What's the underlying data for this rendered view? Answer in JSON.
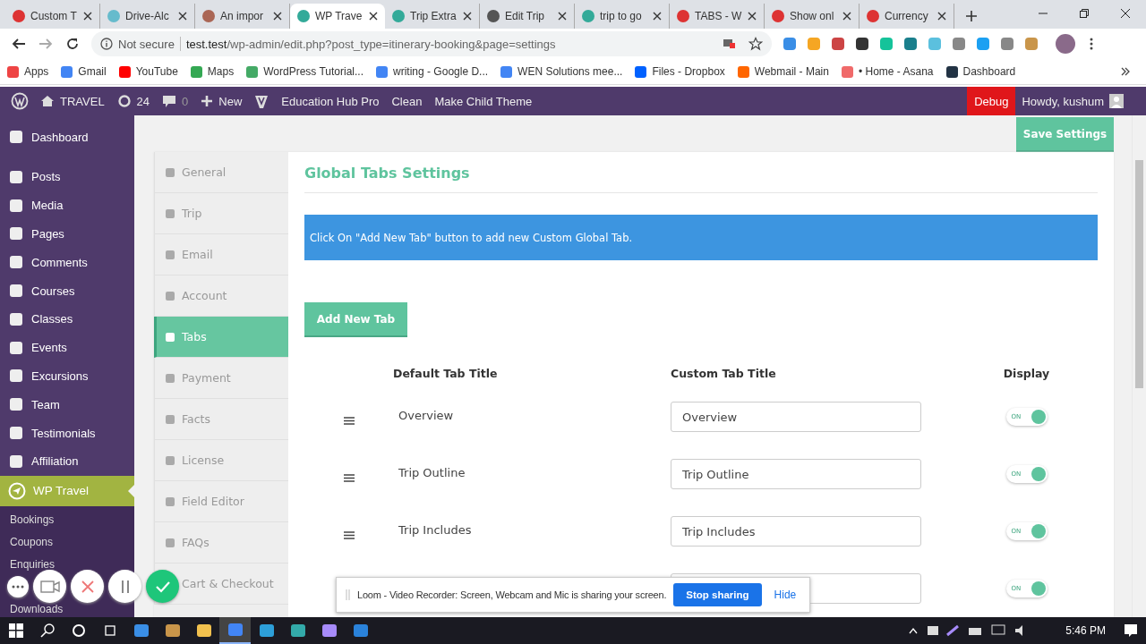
{
  "browser": {
    "tabs": [
      {
        "title": "Custom T",
        "selected": false
      },
      {
        "title": "Drive-Alc",
        "selected": false
      },
      {
        "title": "An impor",
        "selected": false
      },
      {
        "title": "WP Trave",
        "selected": true
      },
      {
        "title": "Trip Extra",
        "selected": false
      },
      {
        "title": "Edit Trip",
        "selected": false
      },
      {
        "title": "trip to go",
        "selected": false
      },
      {
        "title": "TABS - W",
        "selected": false
      },
      {
        "title": "Show onl",
        "selected": false
      },
      {
        "title": "Currency",
        "selected": false
      }
    ],
    "security": "Not secure",
    "url_host": "test.test",
    "url_path": "/wp-admin/edit.php?post_type=itinerary-booking&page=settings",
    "bookmarks": [
      "Apps",
      "Gmail",
      "YouTube",
      "Maps",
      "WordPress Tutorial...",
      "writing - Google D...",
      "WEN Solutions mee...",
      "Files - Dropbox",
      "Webmail - Main",
      "• Home - Asana",
      "Dashboard"
    ]
  },
  "admin_bar": {
    "site": "TRAVEL",
    "updates": "24",
    "comments": "0",
    "new": "New",
    "links": [
      "Education Hub Pro",
      "Clean",
      "Make Child Theme"
    ],
    "debug": "Debug",
    "howdy": "Howdy, kushum"
  },
  "sidebar": {
    "items": [
      {
        "label": "Dashboard",
        "selected": false
      },
      {
        "label": "Posts",
        "selected": false
      },
      {
        "label": "Media",
        "selected": false
      },
      {
        "label": "Pages",
        "selected": false
      },
      {
        "label": "Comments",
        "selected": false
      },
      {
        "label": "Courses",
        "selected": false
      },
      {
        "label": "Classes",
        "selected": false
      },
      {
        "label": "Events",
        "selected": false
      },
      {
        "label": "Excursions",
        "selected": false
      },
      {
        "label": "Team",
        "selected": false
      },
      {
        "label": "Testimonials",
        "selected": false
      },
      {
        "label": "Affiliation",
        "selected": false
      },
      {
        "label": "WP Travel",
        "selected": true
      }
    ],
    "submenu": [
      "Bookings",
      "Coupons",
      "Enquiries",
      "Downloads"
    ]
  },
  "save_button": "Save Settings",
  "settings_tabs": [
    {
      "label": "General",
      "selected": false
    },
    {
      "label": "Trip",
      "selected": false
    },
    {
      "label": "Email",
      "selected": false
    },
    {
      "label": "Account",
      "selected": false
    },
    {
      "label": "Tabs",
      "selected": true
    },
    {
      "label": "Payment",
      "selected": false
    },
    {
      "label": "Facts",
      "selected": false
    },
    {
      "label": "License",
      "selected": false
    },
    {
      "label": "Field Editor",
      "selected": false
    },
    {
      "label": "FAQs",
      "selected": false
    },
    {
      "label": "Cart & Checkout",
      "selected": false
    }
  ],
  "panel": {
    "heading": "Global Tabs Settings",
    "notice": "Click On \"Add New Tab\" button to add new Custom Global Tab.",
    "add_button": "Add New Tab",
    "columns": [
      "Default Tab Title",
      "Custom Tab Title",
      "Display"
    ],
    "rows": [
      {
        "default_title": "Overview",
        "custom_title": "Overview",
        "display_on": true,
        "display_label": "ON"
      },
      {
        "default_title": "Trip Outline",
        "custom_title": "Trip Outline",
        "display_on": true,
        "display_label": "ON"
      },
      {
        "default_title": "Trip Includes",
        "custom_title": "Trip Includes",
        "display_on": true,
        "display_label": "ON"
      },
      {
        "display_on": true,
        "display_label": "ON"
      }
    ]
  },
  "loom": {
    "message": "Loom - Video Recorder: Screen, Webcam and Mic is sharing your screen.",
    "stop": "Stop sharing",
    "hide": "Hide"
  },
  "taskbar": {
    "time": "5:46 PM"
  }
}
